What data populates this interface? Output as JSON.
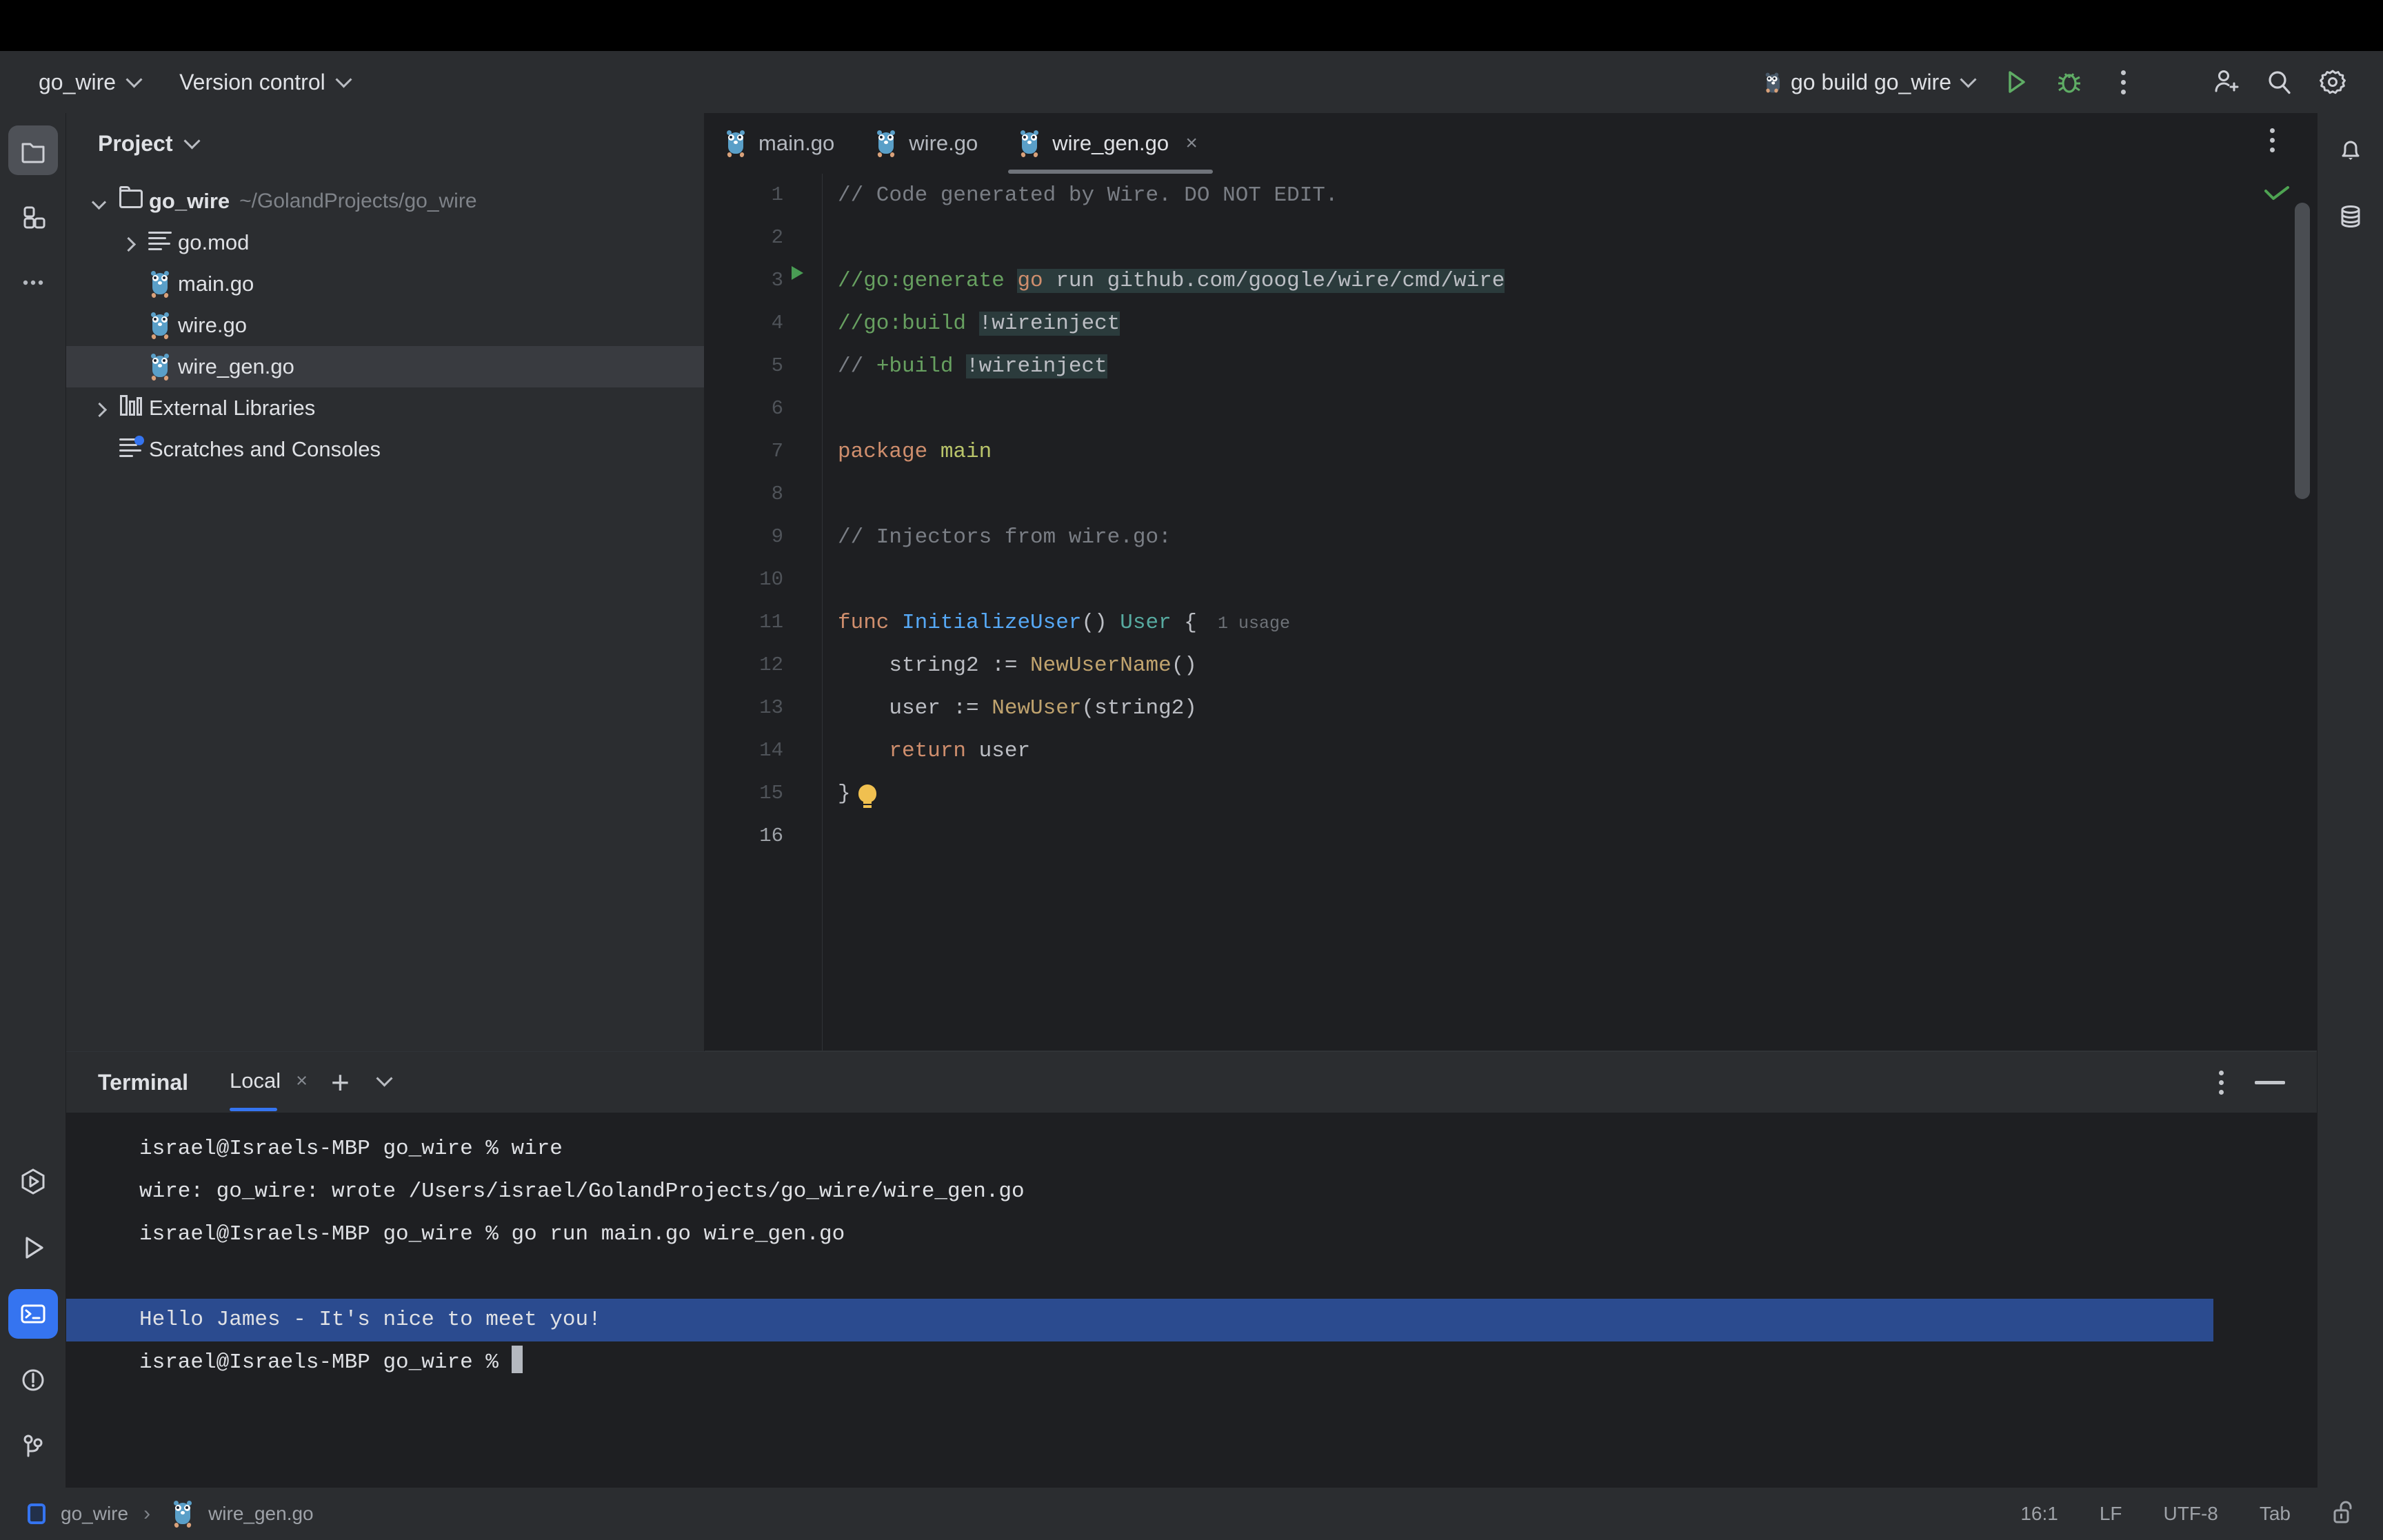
{
  "toolbar": {
    "project_menu": "go_wire",
    "vcs_menu": "Version control",
    "run_config": "go build go_wire",
    "run_icon": "run-play-icon",
    "debug_icon": "debug-bug-icon",
    "more_icon": "more-vertical-icon",
    "account_icon": "add-account-icon",
    "search_icon": "search-icon",
    "settings_icon": "gear-icon"
  },
  "left_rail": {
    "top": [
      {
        "name": "project-tool-window",
        "icon": "folder-icon",
        "active": true
      },
      {
        "name": "structure-tool-window",
        "icon": "modules-grid-icon",
        "active": false
      },
      {
        "name": "more-tool-windows",
        "icon": "ellipsis-icon",
        "active": false
      }
    ],
    "bottom": [
      {
        "name": "run-anything",
        "icon": "hexagon-play-icon",
        "active": false
      },
      {
        "name": "run-tool-window",
        "icon": "play-triangle-icon",
        "active": false
      },
      {
        "name": "terminal-tool-window",
        "icon": "terminal-prompt-icon",
        "active": true
      },
      {
        "name": "problems-tool-window",
        "icon": "warning-circle-icon",
        "active": false
      },
      {
        "name": "version-control-tool-window",
        "icon": "git-branch-icon",
        "active": false
      }
    ]
  },
  "right_rail": [
    {
      "name": "notifications",
      "icon": "bell-icon"
    },
    {
      "name": "database",
      "icon": "database-icon"
    }
  ],
  "project": {
    "title": "Project",
    "chevron_icon": "chevron-down-icon",
    "tree": [
      {
        "label": "go_wire",
        "sub": "~/GolandProjects/go_wire",
        "icon": "folder-icon",
        "arrow": "down",
        "depth": 0,
        "bold": true,
        "selected": false
      },
      {
        "label": "go.mod",
        "sub": "",
        "icon": "lines-icon",
        "arrow": "right",
        "depth": 1,
        "bold": false,
        "selected": false
      },
      {
        "label": "main.go",
        "sub": "",
        "icon": "go-file-icon",
        "arrow": "",
        "depth": 1,
        "bold": false,
        "selected": false
      },
      {
        "label": "wire.go",
        "sub": "",
        "icon": "go-file-icon",
        "arrow": "",
        "depth": 1,
        "bold": false,
        "selected": false
      },
      {
        "label": "wire_gen.go",
        "sub": "",
        "icon": "go-file-icon",
        "arrow": "",
        "depth": 1,
        "bold": false,
        "selected": true
      },
      {
        "label": "External Libraries",
        "sub": "",
        "icon": "libraries-icon",
        "arrow": "right",
        "depth": 0,
        "bold": false,
        "selected": false
      },
      {
        "label": "Scratches and Consoles",
        "sub": "",
        "icon": "scratches-icon",
        "arrow": "",
        "depth": 0,
        "bold": false,
        "selected": false
      }
    ]
  },
  "editor": {
    "tabs": [
      {
        "label": "main.go",
        "icon": "go-file-icon",
        "active": false,
        "closable": false
      },
      {
        "label": "wire.go",
        "icon": "go-file-icon",
        "active": false,
        "closable": false
      },
      {
        "label": "wire_gen.go",
        "icon": "go-file-icon",
        "active": true,
        "closable": true
      }
    ],
    "tab_close_glyph": "×",
    "options_icon": "more-vertical-icon",
    "inspection_icon": "inspection-ok-checkmark",
    "run_gutter_icon": "run-gutter-play-icon",
    "intention_icon": "lightbulb-icon",
    "line_numbers": [
      1,
      2,
      3,
      4,
      5,
      6,
      7,
      8,
      9,
      10,
      11,
      12,
      13,
      14,
      15,
      16
    ],
    "caret_line": 16,
    "lines": [
      {
        "n": 1,
        "text": "// Code generated by Wire. DO NOT EDIT."
      },
      {
        "n": 2,
        "text": ""
      },
      {
        "n": 3,
        "text": "//go:generate go run github.com/google/wire/cmd/wire"
      },
      {
        "n": 4,
        "text": "//go:build !wireinject"
      },
      {
        "n": 5,
        "text": "// +build !wireinject"
      },
      {
        "n": 6,
        "text": ""
      },
      {
        "n": 7,
        "text": "package main"
      },
      {
        "n": 8,
        "text": ""
      },
      {
        "n": 9,
        "text": "// Injectors from wire.go:"
      },
      {
        "n": 10,
        "text": ""
      },
      {
        "n": 11,
        "text": "func InitializeUser() User {"
      },
      {
        "n": 12,
        "text": "    string2 := NewUserName()"
      },
      {
        "n": 13,
        "text": "    user := NewUser(string2)"
      },
      {
        "n": 14,
        "text": "    return user"
      },
      {
        "n": 15,
        "text": "}"
      },
      {
        "n": 16,
        "text": ""
      }
    ],
    "usage_hint": "1 usage"
  },
  "terminal": {
    "title": "Terminal",
    "tab_label": "Local",
    "tab_close_glyph": "×",
    "new_tab_glyph": "+",
    "dropdown_icon": "chevron-down-icon",
    "options_icon": "more-vertical-icon",
    "minimize_icon": "minimize-icon",
    "lines": [
      {
        "text": "israel@Israels-MBP go_wire % wire",
        "selected": false,
        "blank": false
      },
      {
        "text": "wire: go_wire: wrote /Users/israel/GolandProjects/go_wire/wire_gen.go",
        "selected": false,
        "blank": false
      },
      {
        "text": "israel@Israels-MBP go_wire % go run main.go wire_gen.go",
        "selected": false,
        "blank": false
      },
      {
        "text": "",
        "selected": false,
        "blank": true
      },
      {
        "text": "Hello James - It's nice to meet you!",
        "selected": true,
        "blank": false
      },
      {
        "text": "israel@Israels-MBP go_wire % ",
        "selected": false,
        "blank": false,
        "cursor": true
      }
    ]
  },
  "statusbar": {
    "breadcrumb_module": "go_wire",
    "breadcrumb_sep": "›",
    "breadcrumb_file": "wire_gen.go",
    "module_icon": "module-icon",
    "file_icon": "go-file-icon",
    "caret_position": "16:1",
    "line_separator": "LF",
    "encoding": "UTF-8",
    "indent": "Tab",
    "lock_icon": "unlocked-padlock-icon"
  },
  "colors": {
    "accent_blue": "#3574f0",
    "run_green": "#499c54",
    "selection_blue": "#2b4b8f",
    "highlight_teal": "#2b3b3c",
    "panel_bg": "#2b2d30",
    "editor_bg": "#1e1f22"
  }
}
